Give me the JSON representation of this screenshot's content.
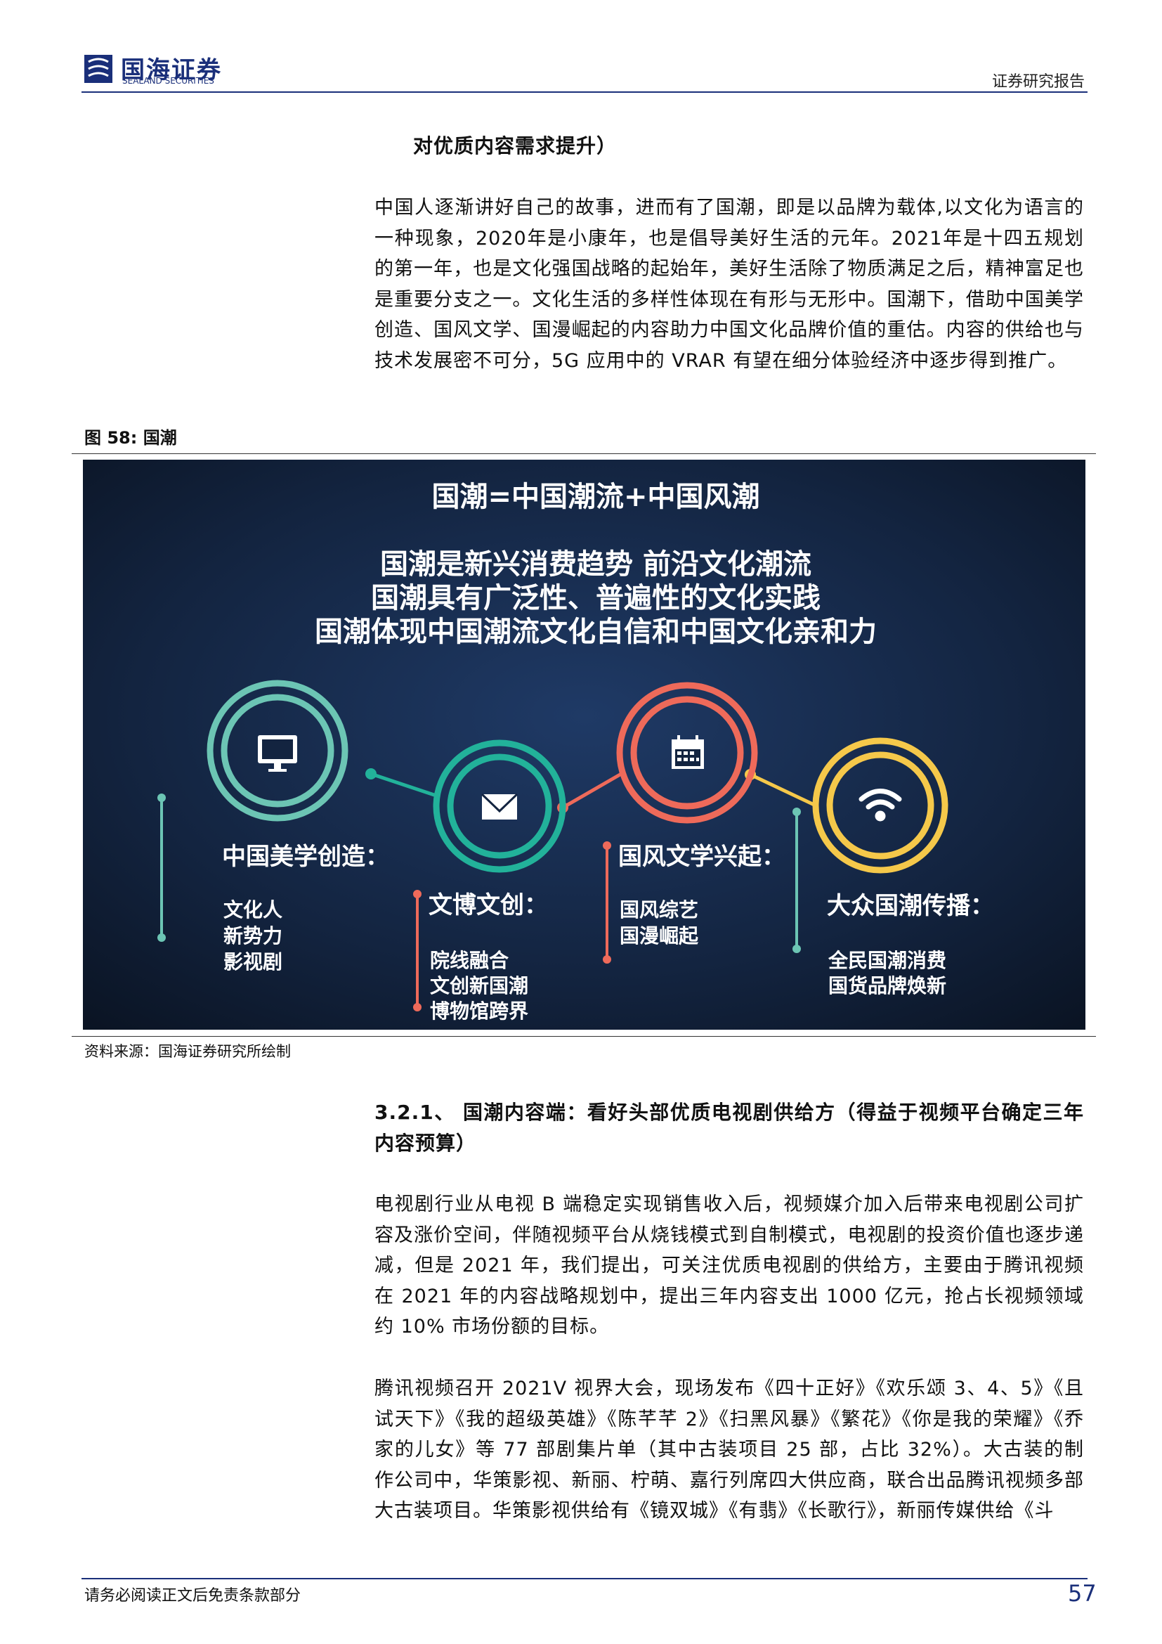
{
  "header": {
    "logo_cn": "国海证券",
    "logo_en": "SEALAND SECURITIES",
    "report_type": "证券研究报告"
  },
  "section_tail": "对优质内容需求提升）",
  "para1": "中国人逐渐讲好自己的故事，进而有了国潮，即是以品牌为载体,以文化为语言的一种现象，2020年是小康年，也是倡导美好生活的元年。2021年是十四五规划的第一年，也是文化强国战略的起始年，美好生活除了物质满足之后，精神富足也是重要分支之一。文化生活的多样性体现在有形与无形中。国潮下，借助中国美学创造、国风文学、国漫崛起的内容助力中国文化品牌价值的重估。内容的供给也与技术发展密不可分，5G 应用中的 VRAR 有望在细分体验经济中逐步得到推广。",
  "figure": {
    "caption": "图 58:  国潮",
    "title": "国潮=中国潮流+中国风潮",
    "lines": [
      "国潮是新兴消费趋势 前沿文化潮流",
      "国潮具有广泛性、普遍性的文化实践",
      "国潮体现中国潮流文化自信和中国文化亲和力"
    ],
    "nodes": [
      {
        "icon": "monitor-icon",
        "color": "#6cc5b4",
        "title": "中国美学创造：",
        "items": [
          "文化人",
          "新势力",
          "影视剧"
        ]
      },
      {
        "icon": "envelope-icon",
        "color": "#22b29a",
        "title": "文博文创：",
        "items": [
          "院线融合",
          "文创新国潮",
          "博物馆跨界"
        ]
      },
      {
        "icon": "calendar-icon",
        "color": "#ee6a5a",
        "title": "国风文学兴起：",
        "items": [
          "国风综艺",
          "国漫崛起"
        ]
      },
      {
        "icon": "wifi-icon",
        "color": "#f5c84a",
        "title": "大众国潮传播：",
        "items": [
          "全民国潮消费",
          "国货品牌焕新"
        ]
      }
    ],
    "source": "资料来源：国海证券研究所绘制"
  },
  "section": {
    "number": "3.2.1、",
    "title": "国潮内容端：看好头部优质电视剧供给方（得益于视频平台确定三年内容预算）"
  },
  "para2": "电视剧行业从电视 B 端稳定实现销售收入后，视频媒介加入后带来电视剧公司扩容及涨价空间，伴随视频平台从烧钱模式到自制模式，电视剧的投资价值也逐步递减，但是 2021 年，我们提出，可关注优质电视剧的供给方，主要由于腾讯视频在 2021 年的内容战略规划中，提出三年内容支出 1000 亿元，抢占长视频领域约 10% 市场份额的目标。",
  "para3": "腾讯视频召开 2021V 视界大会，现场发布《四十正好》《欢乐颂 3、4、5》《且试天下》《我的超级英雄》《陈芊芊 2》《扫黑风暴》《繁花》《你是我的荣耀》《乔家的儿女》等 77 部剧集片单（其中古装项目 25 部，占比 32%）。大古装的制作公司中，华策影视、新丽、柠萌、嘉行列席四大供应商，联合出品腾讯视频多部大古装项目。华策影视供给有《镜双城》《有翡》《长歌行》，新丽传媒供给《斗",
  "footer": {
    "disclaimer": "请务必阅读正文后免责条款部分",
    "page": "57"
  }
}
